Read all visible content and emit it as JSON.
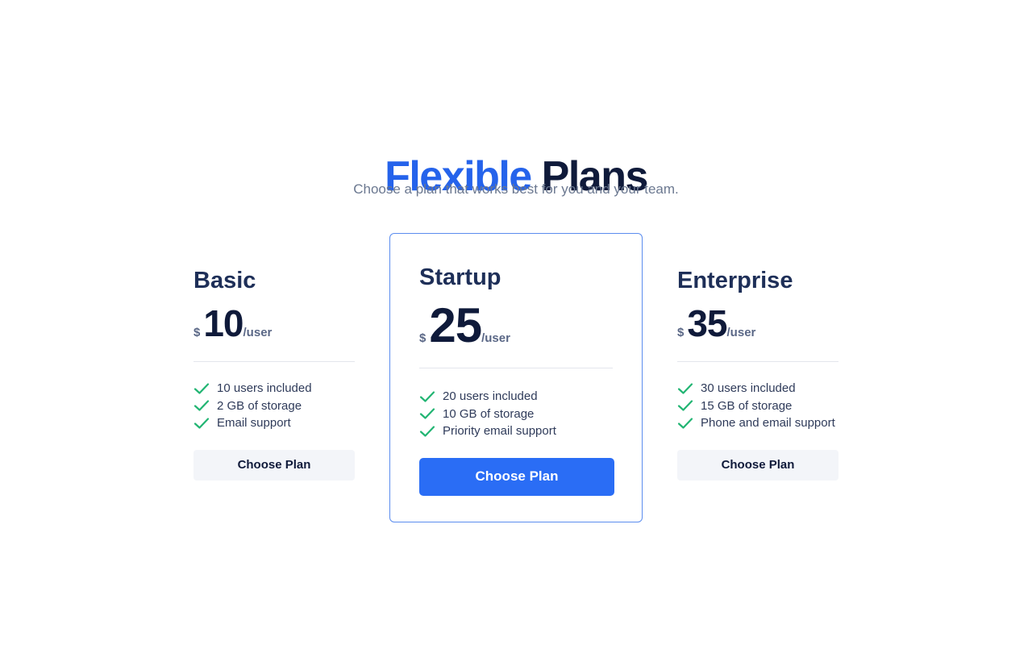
{
  "header": {
    "title_accent": "Flexible",
    "title_rest": "Plans",
    "subtitle": "Choose a plan that works best for you and your team."
  },
  "colors": {
    "accent": "#2563eb",
    "check": "#22b573",
    "primary_button": "#2a6df5"
  },
  "plans": [
    {
      "name": "Basic",
      "currency": "$",
      "price": "10",
      "unit": "/user",
      "features": [
        "10 users included",
        "2 GB of storage",
        "Email support"
      ],
      "button_label": "Choose Plan"
    },
    {
      "name": "Startup",
      "currency": "$",
      "price": "25",
      "unit": "/user",
      "features": [
        "20 users included",
        "10 GB of storage",
        "Priority email support"
      ],
      "button_label": "Choose Plan"
    },
    {
      "name": "Enterprise",
      "currency": "$",
      "price": "35",
      "unit": "/user",
      "features": [
        "30 users included",
        "15 GB of storage",
        "Phone and email support"
      ],
      "button_label": "Choose Plan"
    }
  ]
}
